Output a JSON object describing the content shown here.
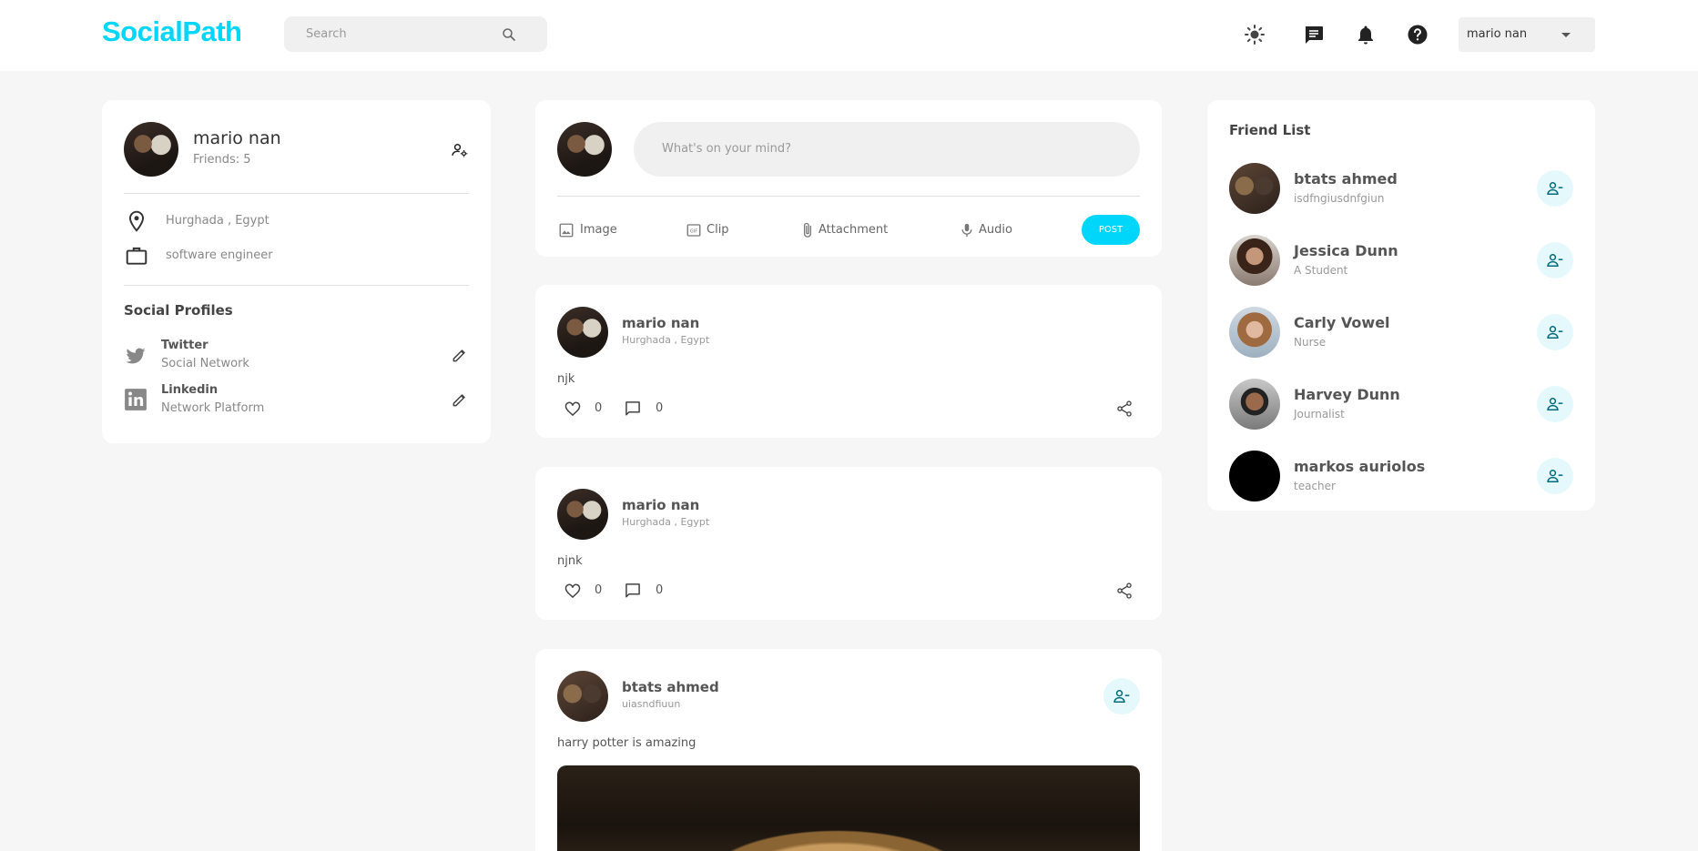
{
  "header": {
    "logo": "SocialPath",
    "search_placeholder": "Search",
    "user_menu_label": "mario nan",
    "icons": [
      "brightness-icon",
      "message-icon",
      "notifications-icon",
      "help-icon"
    ]
  },
  "profile": {
    "name": "mario nan",
    "friends_label": "Friends: 5",
    "location": "Hurghada , Egypt",
    "occupation": "software engineer",
    "social_title": "Social Profiles",
    "socials": [
      {
        "name": "Twitter",
        "subtitle": "Social Network",
        "icon": "twitter-icon"
      },
      {
        "name": "Linkedin",
        "subtitle": "Network Platform",
        "icon": "linkedin-icon"
      }
    ]
  },
  "composer": {
    "placeholder": "What's on your mind?",
    "options": [
      {
        "label": "Image",
        "icon": "image-icon"
      },
      {
        "label": "Clip",
        "icon": "gif-icon"
      },
      {
        "label": "Attachment",
        "icon": "attachment-icon"
      },
      {
        "label": "Audio",
        "icon": "mic-icon"
      }
    ],
    "post_label": "POST"
  },
  "posts": [
    {
      "author": "mario nan",
      "subtitle": "Hurghada , Egypt",
      "text": "njk",
      "likes": "0",
      "comments": "0"
    },
    {
      "author": "mario nan",
      "subtitle": "Hurghada , Egypt",
      "text": "njnk",
      "likes": "0",
      "comments": "0"
    },
    {
      "author": "btats ahmed",
      "subtitle": "uiasndfiuun",
      "text": "harry potter is amazing"
    }
  ],
  "friend_list": {
    "title": "Friend List",
    "friends": [
      {
        "name": "btats ahmed",
        "subtitle": "isdfngiusdnfgiun"
      },
      {
        "name": "Jessica Dunn",
        "subtitle": "A Student"
      },
      {
        "name": "Carly Vowel",
        "subtitle": "Nurse"
      },
      {
        "name": "Harvey Dunn",
        "subtitle": "Journalist"
      },
      {
        "name": "markos auriolos",
        "subtitle": "teacher"
      }
    ]
  },
  "colors": {
    "accent": "#00d5fa",
    "accent_light": "#e5f9fd",
    "icon_teal": "#006b7d",
    "background": "#f6f6f6"
  }
}
